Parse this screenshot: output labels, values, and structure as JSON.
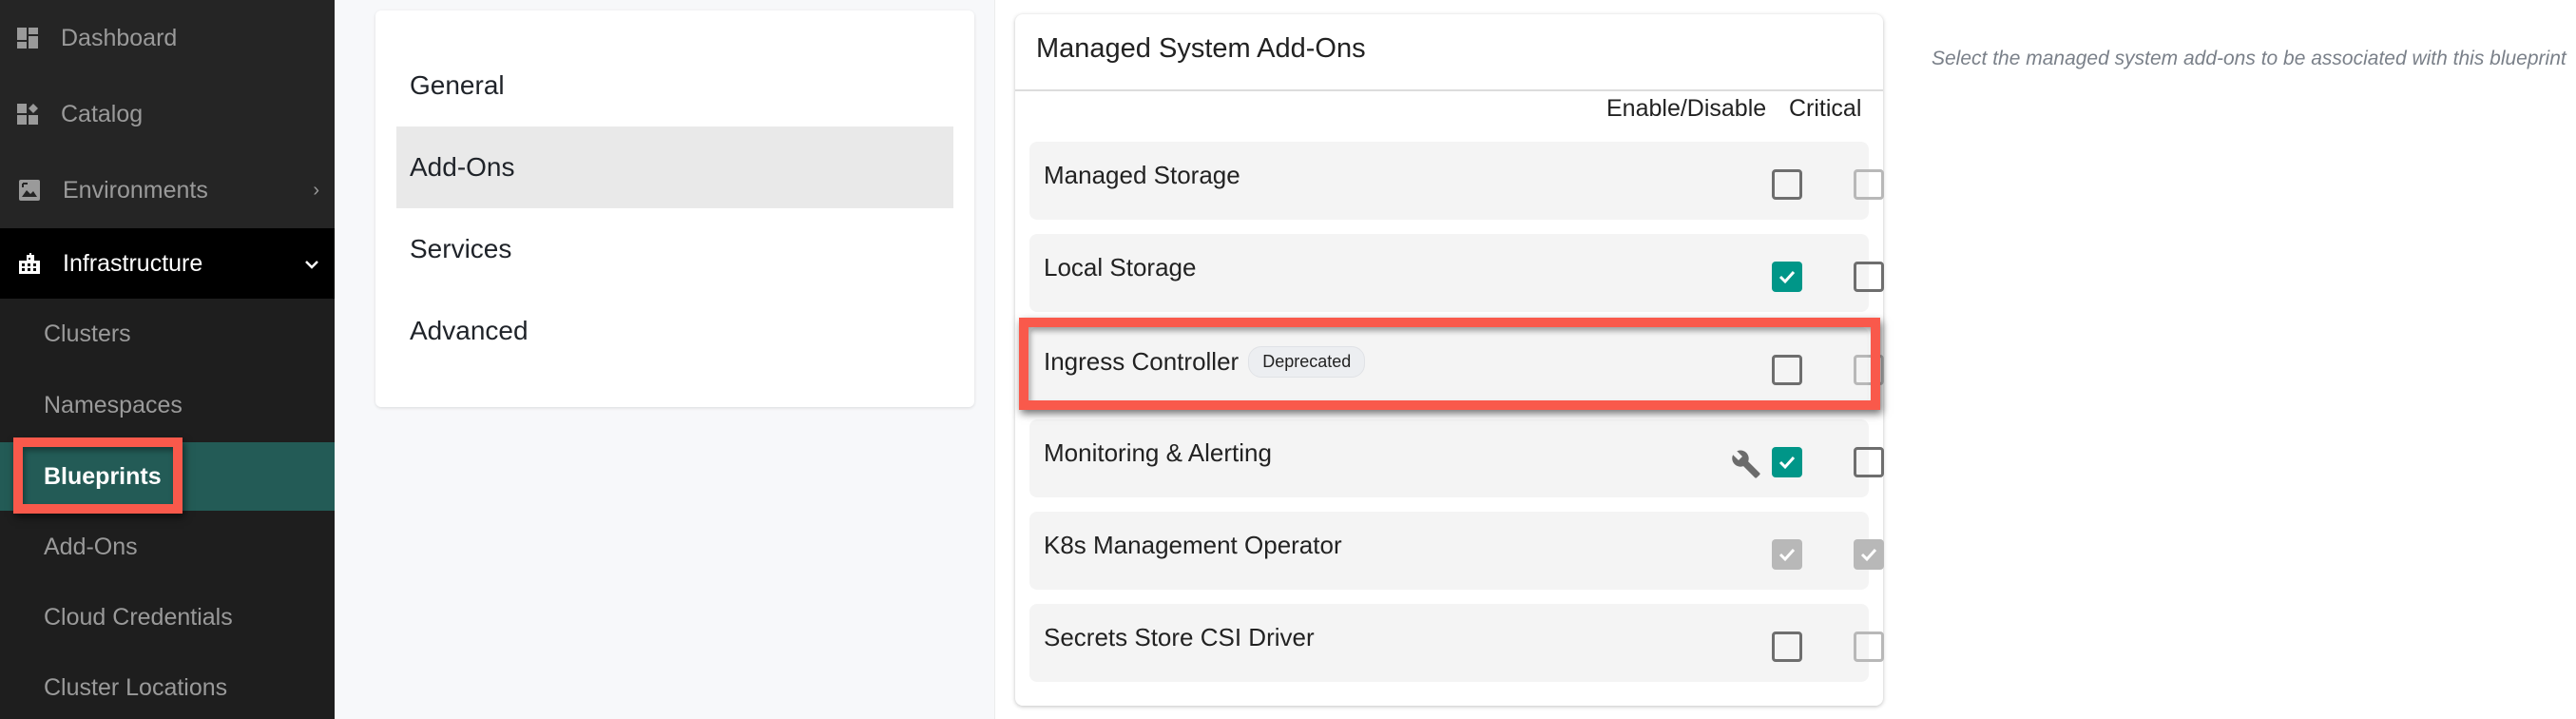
{
  "sidebar": {
    "items": [
      {
        "label": "Dashboard",
        "icon": "dashboard-icon"
      },
      {
        "label": "Catalog",
        "icon": "catalog-icon"
      },
      {
        "label": "Environments",
        "icon": "image-icon",
        "chevron": "›"
      },
      {
        "label": "Infrastructure",
        "icon": "building-icon",
        "chevron": "⌄",
        "expanded": true
      }
    ],
    "sub_items": [
      {
        "label": "Clusters"
      },
      {
        "label": "Namespaces"
      },
      {
        "label": "Blueprints",
        "active": true
      },
      {
        "label": "Add-Ons"
      },
      {
        "label": "Cloud Credentials"
      },
      {
        "label": "Cluster Locations"
      }
    ]
  },
  "tabs": [
    {
      "label": "General"
    },
    {
      "label": "Add-Ons",
      "selected": true
    },
    {
      "label": "Services"
    },
    {
      "label": "Advanced"
    }
  ],
  "addons_card": {
    "title": "Managed System Add-Ons",
    "columns": {
      "enable": "Enable/Disable",
      "critical": "Critical"
    },
    "rows": [
      {
        "name": "Managed Storage",
        "badge": null,
        "enabled": false,
        "enabled_disabled": false,
        "critical": false,
        "critical_disabled": true,
        "wrench": false
      },
      {
        "name": "Local Storage",
        "badge": null,
        "enabled": true,
        "enabled_disabled": false,
        "critical": false,
        "critical_disabled": false,
        "wrench": false
      },
      {
        "name": "Ingress Controller",
        "badge": "Deprecated",
        "enabled": false,
        "enabled_disabled": false,
        "critical": false,
        "critical_disabled": true,
        "wrench": false
      },
      {
        "name": "Monitoring & Alerting",
        "badge": null,
        "enabled": true,
        "enabled_disabled": false,
        "critical": false,
        "critical_disabled": false,
        "wrench": true
      },
      {
        "name": "K8s Management Operator",
        "badge": null,
        "enabled": true,
        "enabled_disabled": true,
        "critical": true,
        "critical_disabled": true,
        "wrench": false
      },
      {
        "name": "Secrets Store CSI Driver",
        "badge": null,
        "enabled": false,
        "enabled_disabled": false,
        "critical": false,
        "critical_disabled": true,
        "wrench": false
      }
    ]
  },
  "description": "Select the managed system add-ons to be associated with this blueprint",
  "colors": {
    "accent": "#009688",
    "sidebar_active": "#235b56",
    "highlight": "#f9594b"
  }
}
